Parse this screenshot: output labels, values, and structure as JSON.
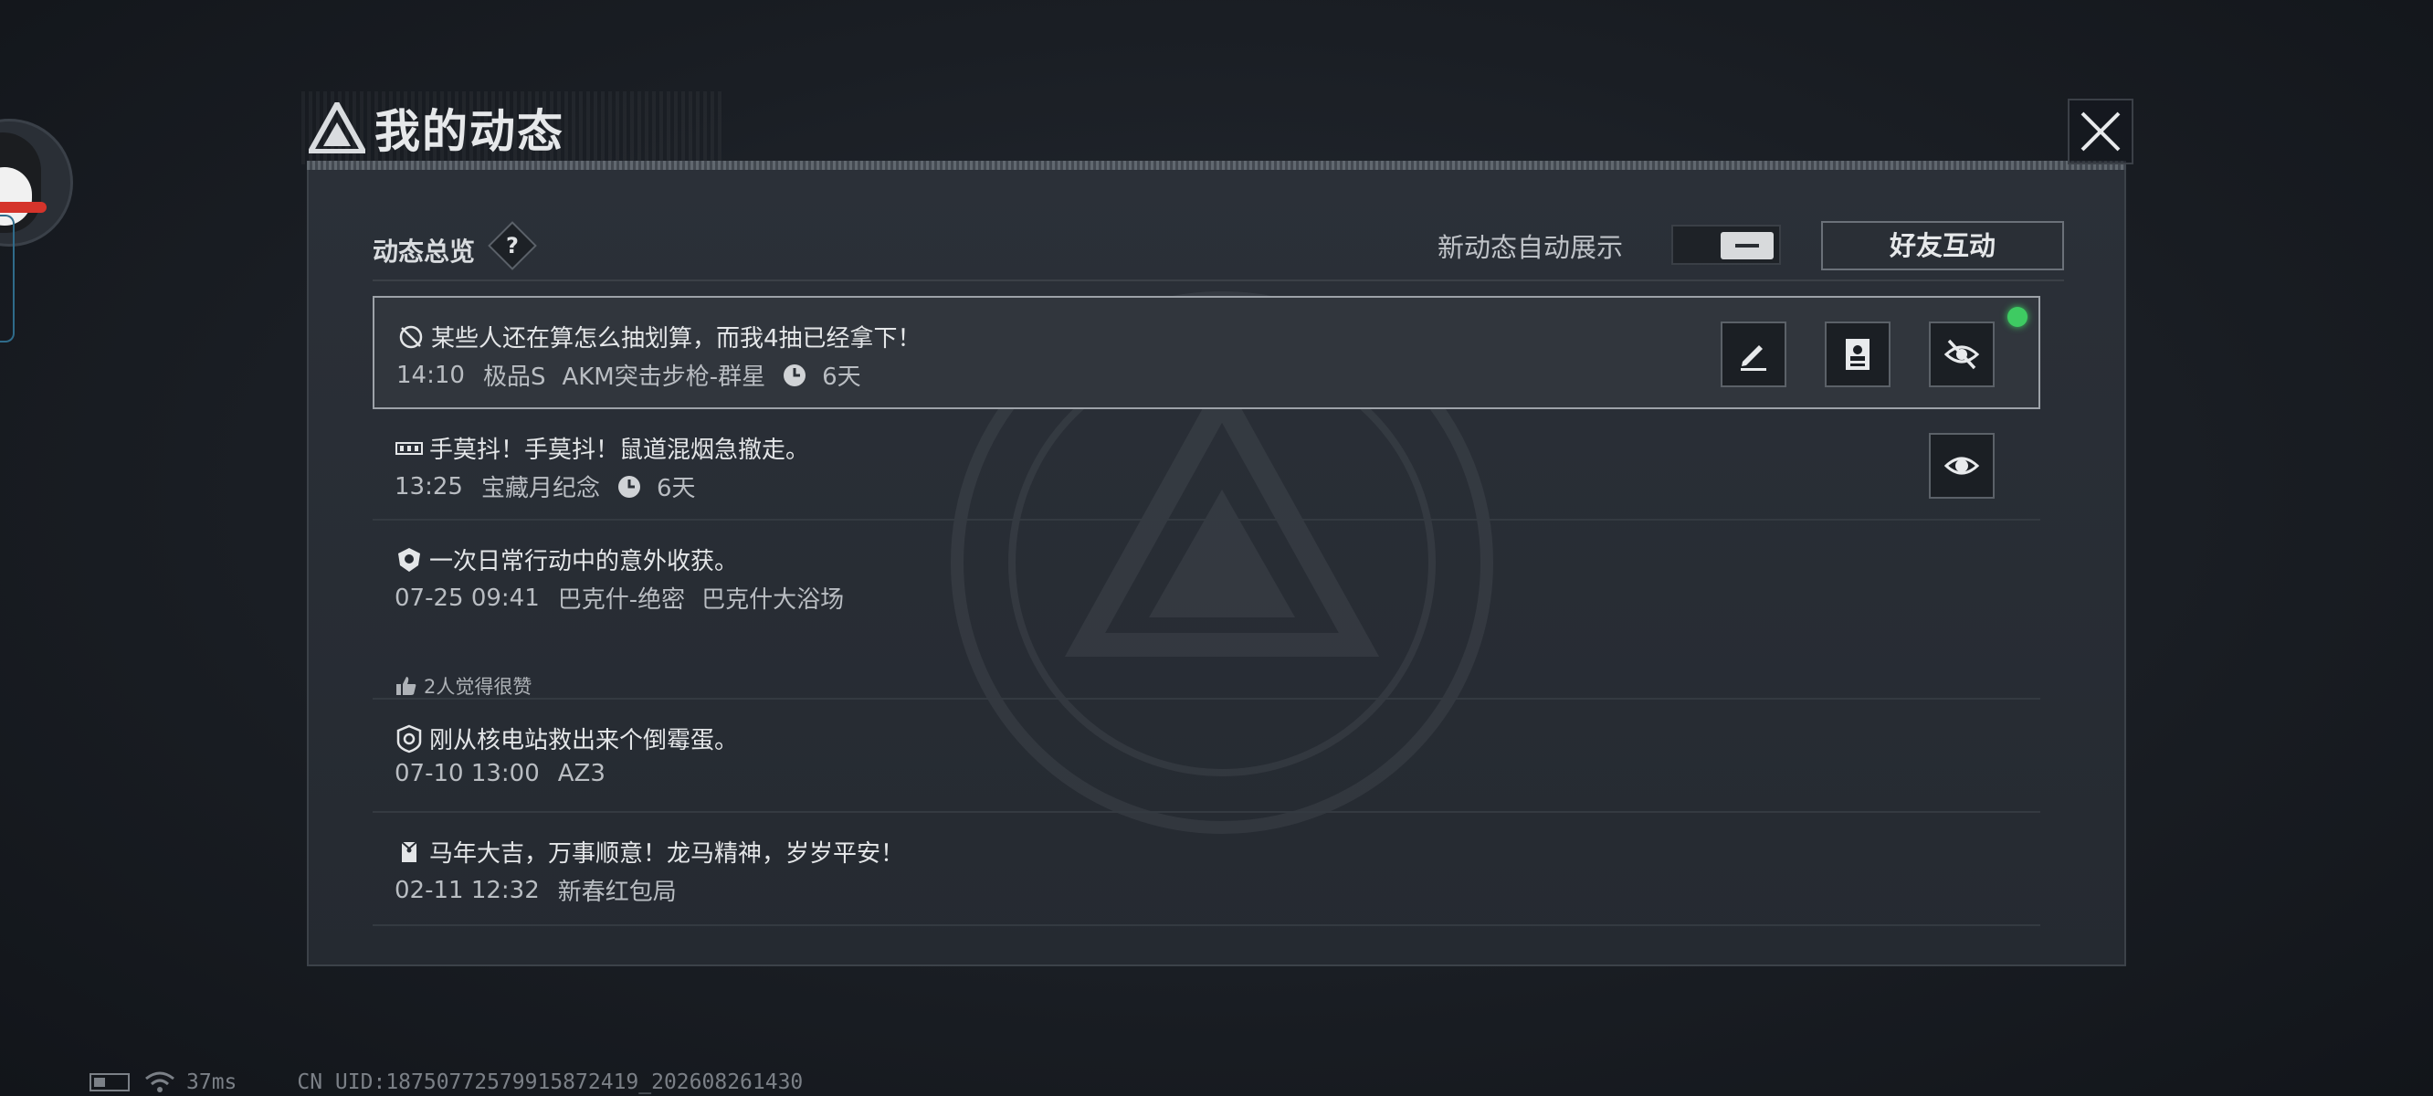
{
  "header": {
    "title": "我的动态"
  },
  "panel": {
    "overview_title": "动态总览",
    "help_symbol": "?",
    "auto_show_label": "新动态自动展示",
    "auto_show_toggle": "off",
    "friend_button": "好友互动"
  },
  "feed": [
    {
      "icon": "cancel-gift-icon",
      "text": "某些人还在算怎么抽划算，而我4抽已经拿下！",
      "time": "14:10",
      "tags": [
        "极品S",
        "AKM突击步枪-群星"
      ],
      "duration": "6天",
      "selected": true,
      "has_new_dot": true,
      "actions": [
        "edit",
        "profile",
        "hide"
      ]
    },
    {
      "icon": "medal-bar-icon",
      "text": "手莫抖！手莫抖！鼠道混烟急撤走。",
      "time": "13:25",
      "tags": [
        "宝藏月纪念"
      ],
      "duration": "6天",
      "actions": [
        "show"
      ]
    },
    {
      "icon": "shield-emblem-icon",
      "text": "一次日常行动中的意外收获。",
      "time": "07-25 09:41",
      "tags": [
        "巴克什-绝密",
        "巴克什大浴场"
      ],
      "likes": "2人觉得很赞"
    },
    {
      "icon": "badge-icon",
      "text": "刚从核电站救出来个倒霉蛋。",
      "time": "07-10 13:00",
      "tags": [
        "AZ3"
      ]
    },
    {
      "icon": "red-envelope-icon",
      "text": "马年大吉，万事顺意！龙马精神，岁岁平安！",
      "time": "02-11 12:32",
      "tags": [
        "新春红包局"
      ]
    }
  ],
  "status_bar": {
    "ping": "37ms",
    "uid": "CN UID:18750772579915872419_202608261430"
  }
}
